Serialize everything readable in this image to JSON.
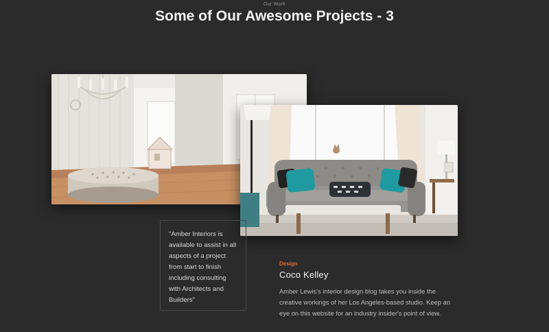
{
  "section": {
    "eyebrow": "Our Work",
    "title": "Some of Our Awesome Projects - 3"
  },
  "images": {
    "left": {
      "subject": "bright living room with tufted ottoman and chandelier"
    },
    "right": {
      "subject": "grey tufted sofa with teal pillows and coffee table"
    }
  },
  "quote": {
    "text": "\"Amber Interiors is available to assist in all aspects of a project from start to finish including consulting with Architects and Builders\""
  },
  "project": {
    "category": "Design",
    "name": "Coco Kelley",
    "description": "Amber Lewis's interior design blog takes you inside the creative workings of her Los Angeles-based studio. Keep an eye on this website for an industry insider's point of view."
  },
  "colors": {
    "background": "#2b2b2b",
    "accent": "#e06a35",
    "text": "#f2f2f2"
  }
}
